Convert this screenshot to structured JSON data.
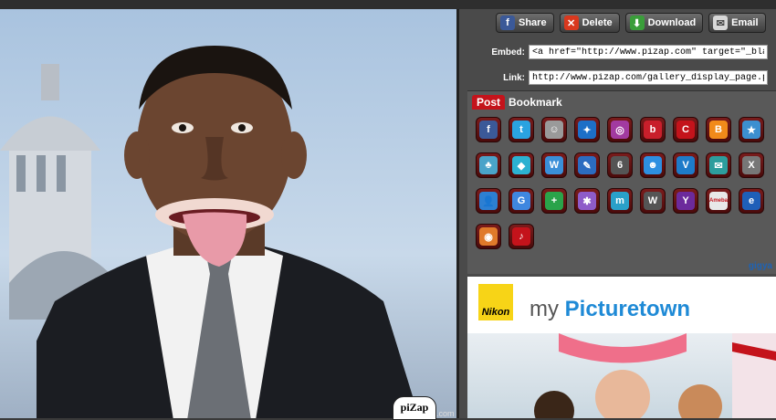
{
  "actions": {
    "share": {
      "label": "Share",
      "color": "#3b5998"
    },
    "delete": {
      "label": "Delete",
      "color": "#d9381e"
    },
    "download": {
      "label": "Download",
      "color": "#3a9e3a"
    },
    "email": {
      "label": "Email",
      "color": "#d8d8d8"
    }
  },
  "embed": {
    "label": "Embed:",
    "value": "<a href=\"http://www.pizap.com\" target=\"_blank\"><img src=\"http:"
  },
  "link": {
    "label": "Link:",
    "value": "http://www.pizap.com/gallery_display_page.php?imagename=p"
  },
  "bookmark": {
    "tab_post": "Post",
    "tab_bookmark": "Bookmark",
    "services": [
      {
        "icon": "facebook-icon",
        "glyph": "f",
        "bg": "#3b5998"
      },
      {
        "icon": "twitter-icon",
        "glyph": "t",
        "bg": "#2aa3e0"
      },
      {
        "icon": "smiley-icon",
        "glyph": "☺",
        "bg": "#9a9a9a"
      },
      {
        "icon": "myspace-icon",
        "glyph": "✦",
        "bg": "#1d6fc7"
      },
      {
        "icon": "circle-icon",
        "glyph": "◎",
        "bg": "#a23aa0"
      },
      {
        "icon": "bebo-icon",
        "glyph": "b",
        "bg": "#c81f2b"
      },
      {
        "icon": "tumblr-icon",
        "glyph": "C",
        "bg": "#c4131b"
      },
      {
        "icon": "blogger-icon",
        "glyph": "B",
        "bg": "#f18a1a"
      },
      {
        "icon": "star-icon",
        "glyph": "★",
        "bg": "#3c8fd0"
      },
      {
        "icon": "people-icon",
        "glyph": "♣",
        "bg": "#4aa3c9"
      },
      {
        "icon": "diamond-icon",
        "glyph": "◆",
        "bg": "#2cb1d1"
      },
      {
        "icon": "windows-live-icon",
        "glyph": "W",
        "bg": "#3a8fd8"
      },
      {
        "icon": "pencil-icon",
        "glyph": "✎",
        "bg": "#2c6cc0"
      },
      {
        "icon": "six-icon",
        "glyph": "6",
        "bg": "#555555"
      },
      {
        "icon": "smile-blue-icon",
        "glyph": "☻",
        "bg": "#2d8fe1"
      },
      {
        "icon": "v-icon",
        "glyph": "V",
        "bg": "#1e7bc9"
      },
      {
        "icon": "chat-icon",
        "glyph": "✉",
        "bg": "#2d9d9d"
      },
      {
        "icon": "x-icon",
        "glyph": "X",
        "bg": "#777777"
      },
      {
        "icon": "person-icon",
        "glyph": "👤",
        "bg": "#2d7fd2"
      },
      {
        "icon": "google-icon",
        "glyph": "G",
        "bg": "#3f87e0"
      },
      {
        "icon": "plus-icon",
        "glyph": "+",
        "bg": "#2aa34a"
      },
      {
        "icon": "delicious-icon",
        "glyph": "✱",
        "bg": "#8e5bc9"
      },
      {
        "icon": "mixx-icon",
        "glyph": "m",
        "bg": "#2aa0c9"
      },
      {
        "icon": "wordpress-icon",
        "glyph": "W",
        "bg": "#555555"
      },
      {
        "icon": "yahoo-icon",
        "glyph": "Y",
        "bg": "#6c2a9c"
      },
      {
        "icon": "ameba-icon",
        "glyph": "Ameba",
        "bg": "#e8e8e8"
      },
      {
        "icon": "e-icon",
        "glyph": "e",
        "bg": "#1f5fb8"
      },
      {
        "icon": "speech-icon",
        "glyph": "◉",
        "bg": "#e07a2a"
      },
      {
        "icon": "bookmark-red-icon",
        "glyph": "♪",
        "bg": "#c4131b"
      }
    ],
    "gigya_label": "gigya"
  },
  "ad": {
    "brand": "Nikon",
    "title_prefix": "my ",
    "title_strong": "Picturetown"
  },
  "watermark": {
    "badge": "piZap",
    "domain": ".com"
  }
}
